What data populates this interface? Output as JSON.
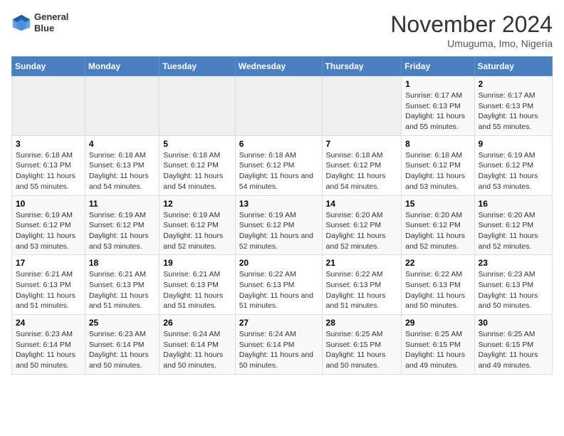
{
  "header": {
    "logo_line1": "General",
    "logo_line2": "Blue",
    "title": "November 2024",
    "subtitle": "Umuguma, Imo, Nigeria"
  },
  "weekdays": [
    "Sunday",
    "Monday",
    "Tuesday",
    "Wednesday",
    "Thursday",
    "Friday",
    "Saturday"
  ],
  "weeks": [
    [
      {
        "day": "",
        "info": ""
      },
      {
        "day": "",
        "info": ""
      },
      {
        "day": "",
        "info": ""
      },
      {
        "day": "",
        "info": ""
      },
      {
        "day": "",
        "info": ""
      },
      {
        "day": "1",
        "info": "Sunrise: 6:17 AM\nSunset: 6:13 PM\nDaylight: 11 hours and 55 minutes."
      },
      {
        "day": "2",
        "info": "Sunrise: 6:17 AM\nSunset: 6:13 PM\nDaylight: 11 hours and 55 minutes."
      }
    ],
    [
      {
        "day": "3",
        "info": "Sunrise: 6:18 AM\nSunset: 6:13 PM\nDaylight: 11 hours and 55 minutes."
      },
      {
        "day": "4",
        "info": "Sunrise: 6:18 AM\nSunset: 6:13 PM\nDaylight: 11 hours and 54 minutes."
      },
      {
        "day": "5",
        "info": "Sunrise: 6:18 AM\nSunset: 6:12 PM\nDaylight: 11 hours and 54 minutes."
      },
      {
        "day": "6",
        "info": "Sunrise: 6:18 AM\nSunset: 6:12 PM\nDaylight: 11 hours and 54 minutes."
      },
      {
        "day": "7",
        "info": "Sunrise: 6:18 AM\nSunset: 6:12 PM\nDaylight: 11 hours and 54 minutes."
      },
      {
        "day": "8",
        "info": "Sunrise: 6:18 AM\nSunset: 6:12 PM\nDaylight: 11 hours and 53 minutes."
      },
      {
        "day": "9",
        "info": "Sunrise: 6:19 AM\nSunset: 6:12 PM\nDaylight: 11 hours and 53 minutes."
      }
    ],
    [
      {
        "day": "10",
        "info": "Sunrise: 6:19 AM\nSunset: 6:12 PM\nDaylight: 11 hours and 53 minutes."
      },
      {
        "day": "11",
        "info": "Sunrise: 6:19 AM\nSunset: 6:12 PM\nDaylight: 11 hours and 53 minutes."
      },
      {
        "day": "12",
        "info": "Sunrise: 6:19 AM\nSunset: 6:12 PM\nDaylight: 11 hours and 52 minutes."
      },
      {
        "day": "13",
        "info": "Sunrise: 6:19 AM\nSunset: 6:12 PM\nDaylight: 11 hours and 52 minutes."
      },
      {
        "day": "14",
        "info": "Sunrise: 6:20 AM\nSunset: 6:12 PM\nDaylight: 11 hours and 52 minutes."
      },
      {
        "day": "15",
        "info": "Sunrise: 6:20 AM\nSunset: 6:12 PM\nDaylight: 11 hours and 52 minutes."
      },
      {
        "day": "16",
        "info": "Sunrise: 6:20 AM\nSunset: 6:12 PM\nDaylight: 11 hours and 52 minutes."
      }
    ],
    [
      {
        "day": "17",
        "info": "Sunrise: 6:21 AM\nSunset: 6:13 PM\nDaylight: 11 hours and 51 minutes."
      },
      {
        "day": "18",
        "info": "Sunrise: 6:21 AM\nSunset: 6:13 PM\nDaylight: 11 hours and 51 minutes."
      },
      {
        "day": "19",
        "info": "Sunrise: 6:21 AM\nSunset: 6:13 PM\nDaylight: 11 hours and 51 minutes."
      },
      {
        "day": "20",
        "info": "Sunrise: 6:22 AM\nSunset: 6:13 PM\nDaylight: 11 hours and 51 minutes."
      },
      {
        "day": "21",
        "info": "Sunrise: 6:22 AM\nSunset: 6:13 PM\nDaylight: 11 hours and 51 minutes."
      },
      {
        "day": "22",
        "info": "Sunrise: 6:22 AM\nSunset: 6:13 PM\nDaylight: 11 hours and 50 minutes."
      },
      {
        "day": "23",
        "info": "Sunrise: 6:23 AM\nSunset: 6:13 PM\nDaylight: 11 hours and 50 minutes."
      }
    ],
    [
      {
        "day": "24",
        "info": "Sunrise: 6:23 AM\nSunset: 6:14 PM\nDaylight: 11 hours and 50 minutes."
      },
      {
        "day": "25",
        "info": "Sunrise: 6:23 AM\nSunset: 6:14 PM\nDaylight: 11 hours and 50 minutes."
      },
      {
        "day": "26",
        "info": "Sunrise: 6:24 AM\nSunset: 6:14 PM\nDaylight: 11 hours and 50 minutes."
      },
      {
        "day": "27",
        "info": "Sunrise: 6:24 AM\nSunset: 6:14 PM\nDaylight: 11 hours and 50 minutes."
      },
      {
        "day": "28",
        "info": "Sunrise: 6:25 AM\nSunset: 6:15 PM\nDaylight: 11 hours and 50 minutes."
      },
      {
        "day": "29",
        "info": "Sunrise: 6:25 AM\nSunset: 6:15 PM\nDaylight: 11 hours and 49 minutes."
      },
      {
        "day": "30",
        "info": "Sunrise: 6:25 AM\nSunset: 6:15 PM\nDaylight: 11 hours and 49 minutes."
      }
    ]
  ]
}
